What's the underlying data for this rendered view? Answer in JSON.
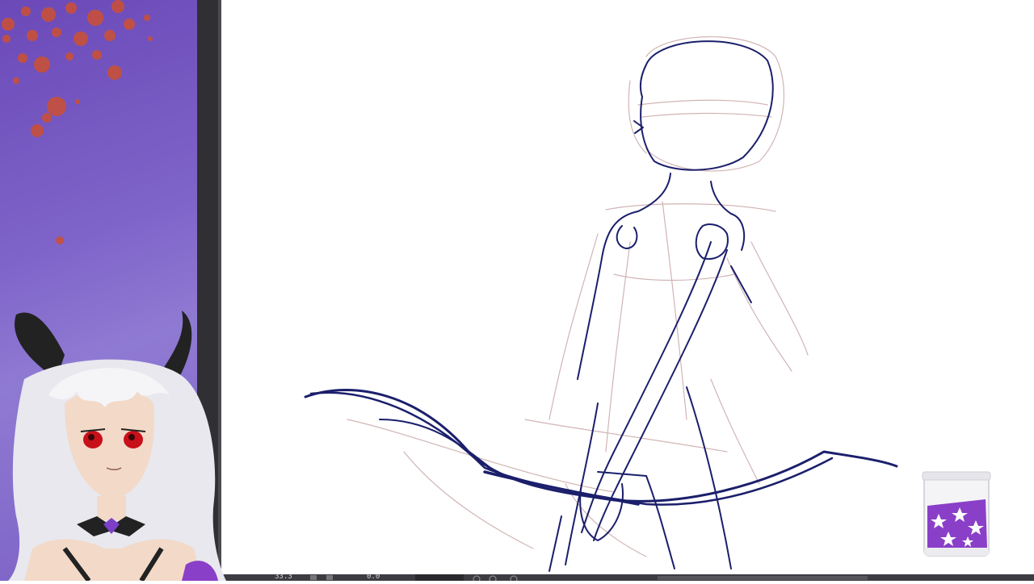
{
  "status_bar": {
    "zoom_label": "33.3",
    "rotation_label": "0.0"
  },
  "colors": {
    "left_panel_purple": "#7a5fc4",
    "splatter_red": "#c8503a",
    "divider_dark": "#2f2f34",
    "sketch_navy": "#1b1f6b",
    "sketch_rough": "#c9a8a8",
    "jar_purple": "#8a3fc8"
  },
  "icons": {
    "jar": "star-jar-icon",
    "avatar": "vtuber-avatar"
  }
}
